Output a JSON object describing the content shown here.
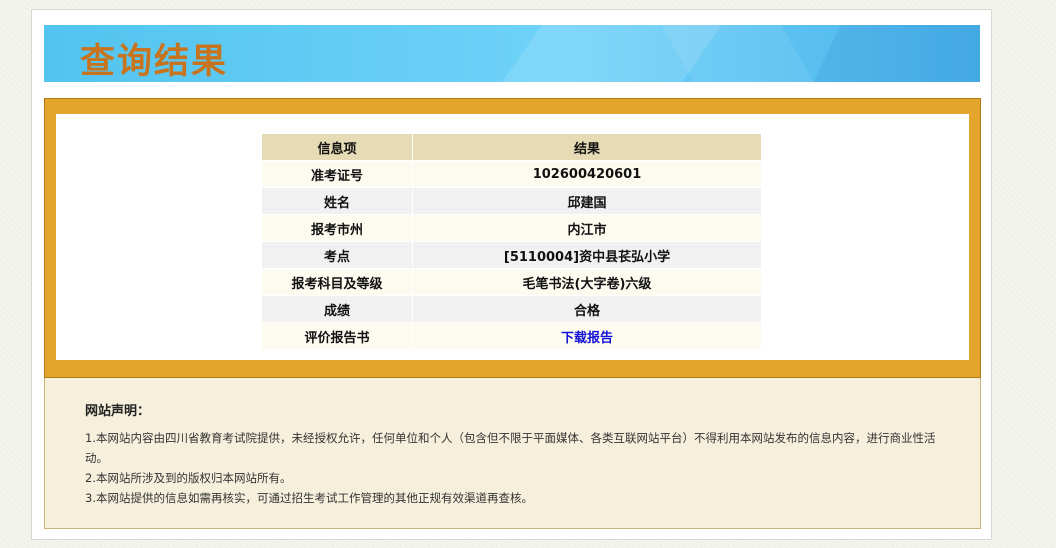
{
  "banner": {
    "title": "查询结果"
  },
  "table": {
    "headers": [
      "信息项",
      "结果"
    ],
    "rows": [
      {
        "key": "准考证号",
        "value": "102600420601"
      },
      {
        "key": "姓名",
        "value": "邱建国"
      },
      {
        "key": "报考市州",
        "value": "内江市"
      },
      {
        "key": "考点",
        "value": "[5110004]资中县苌弘小学"
      },
      {
        "key": "报考科目及等级",
        "value": "毛笔书法(大字卷)六级"
      },
      {
        "key": "成绩",
        "value": "合格"
      },
      {
        "key": "评价报告书",
        "value": "下载报告",
        "is_link": true
      }
    ]
  },
  "notice": {
    "heading": "网站声明：",
    "lines": [
      "1.本网站内容由四川省教育考试院提供，未经授权允许，任何单位和个人（包含但不限于平面媒体、各类互联网站平台）不得利用本网站发布的信息内容，进行商业性活动。",
      "2.本网站所涉及到的版权归本网站所有。",
      "3.本网站提供的信息如需再核实，可通过招生考试工作管理的其他正规有效渠道再查核。"
    ]
  },
  "colors": {
    "banner_title": "#c8741e",
    "frame": "#e3a52b",
    "link": "#1212d8",
    "header_row": "#e6dbb4"
  }
}
